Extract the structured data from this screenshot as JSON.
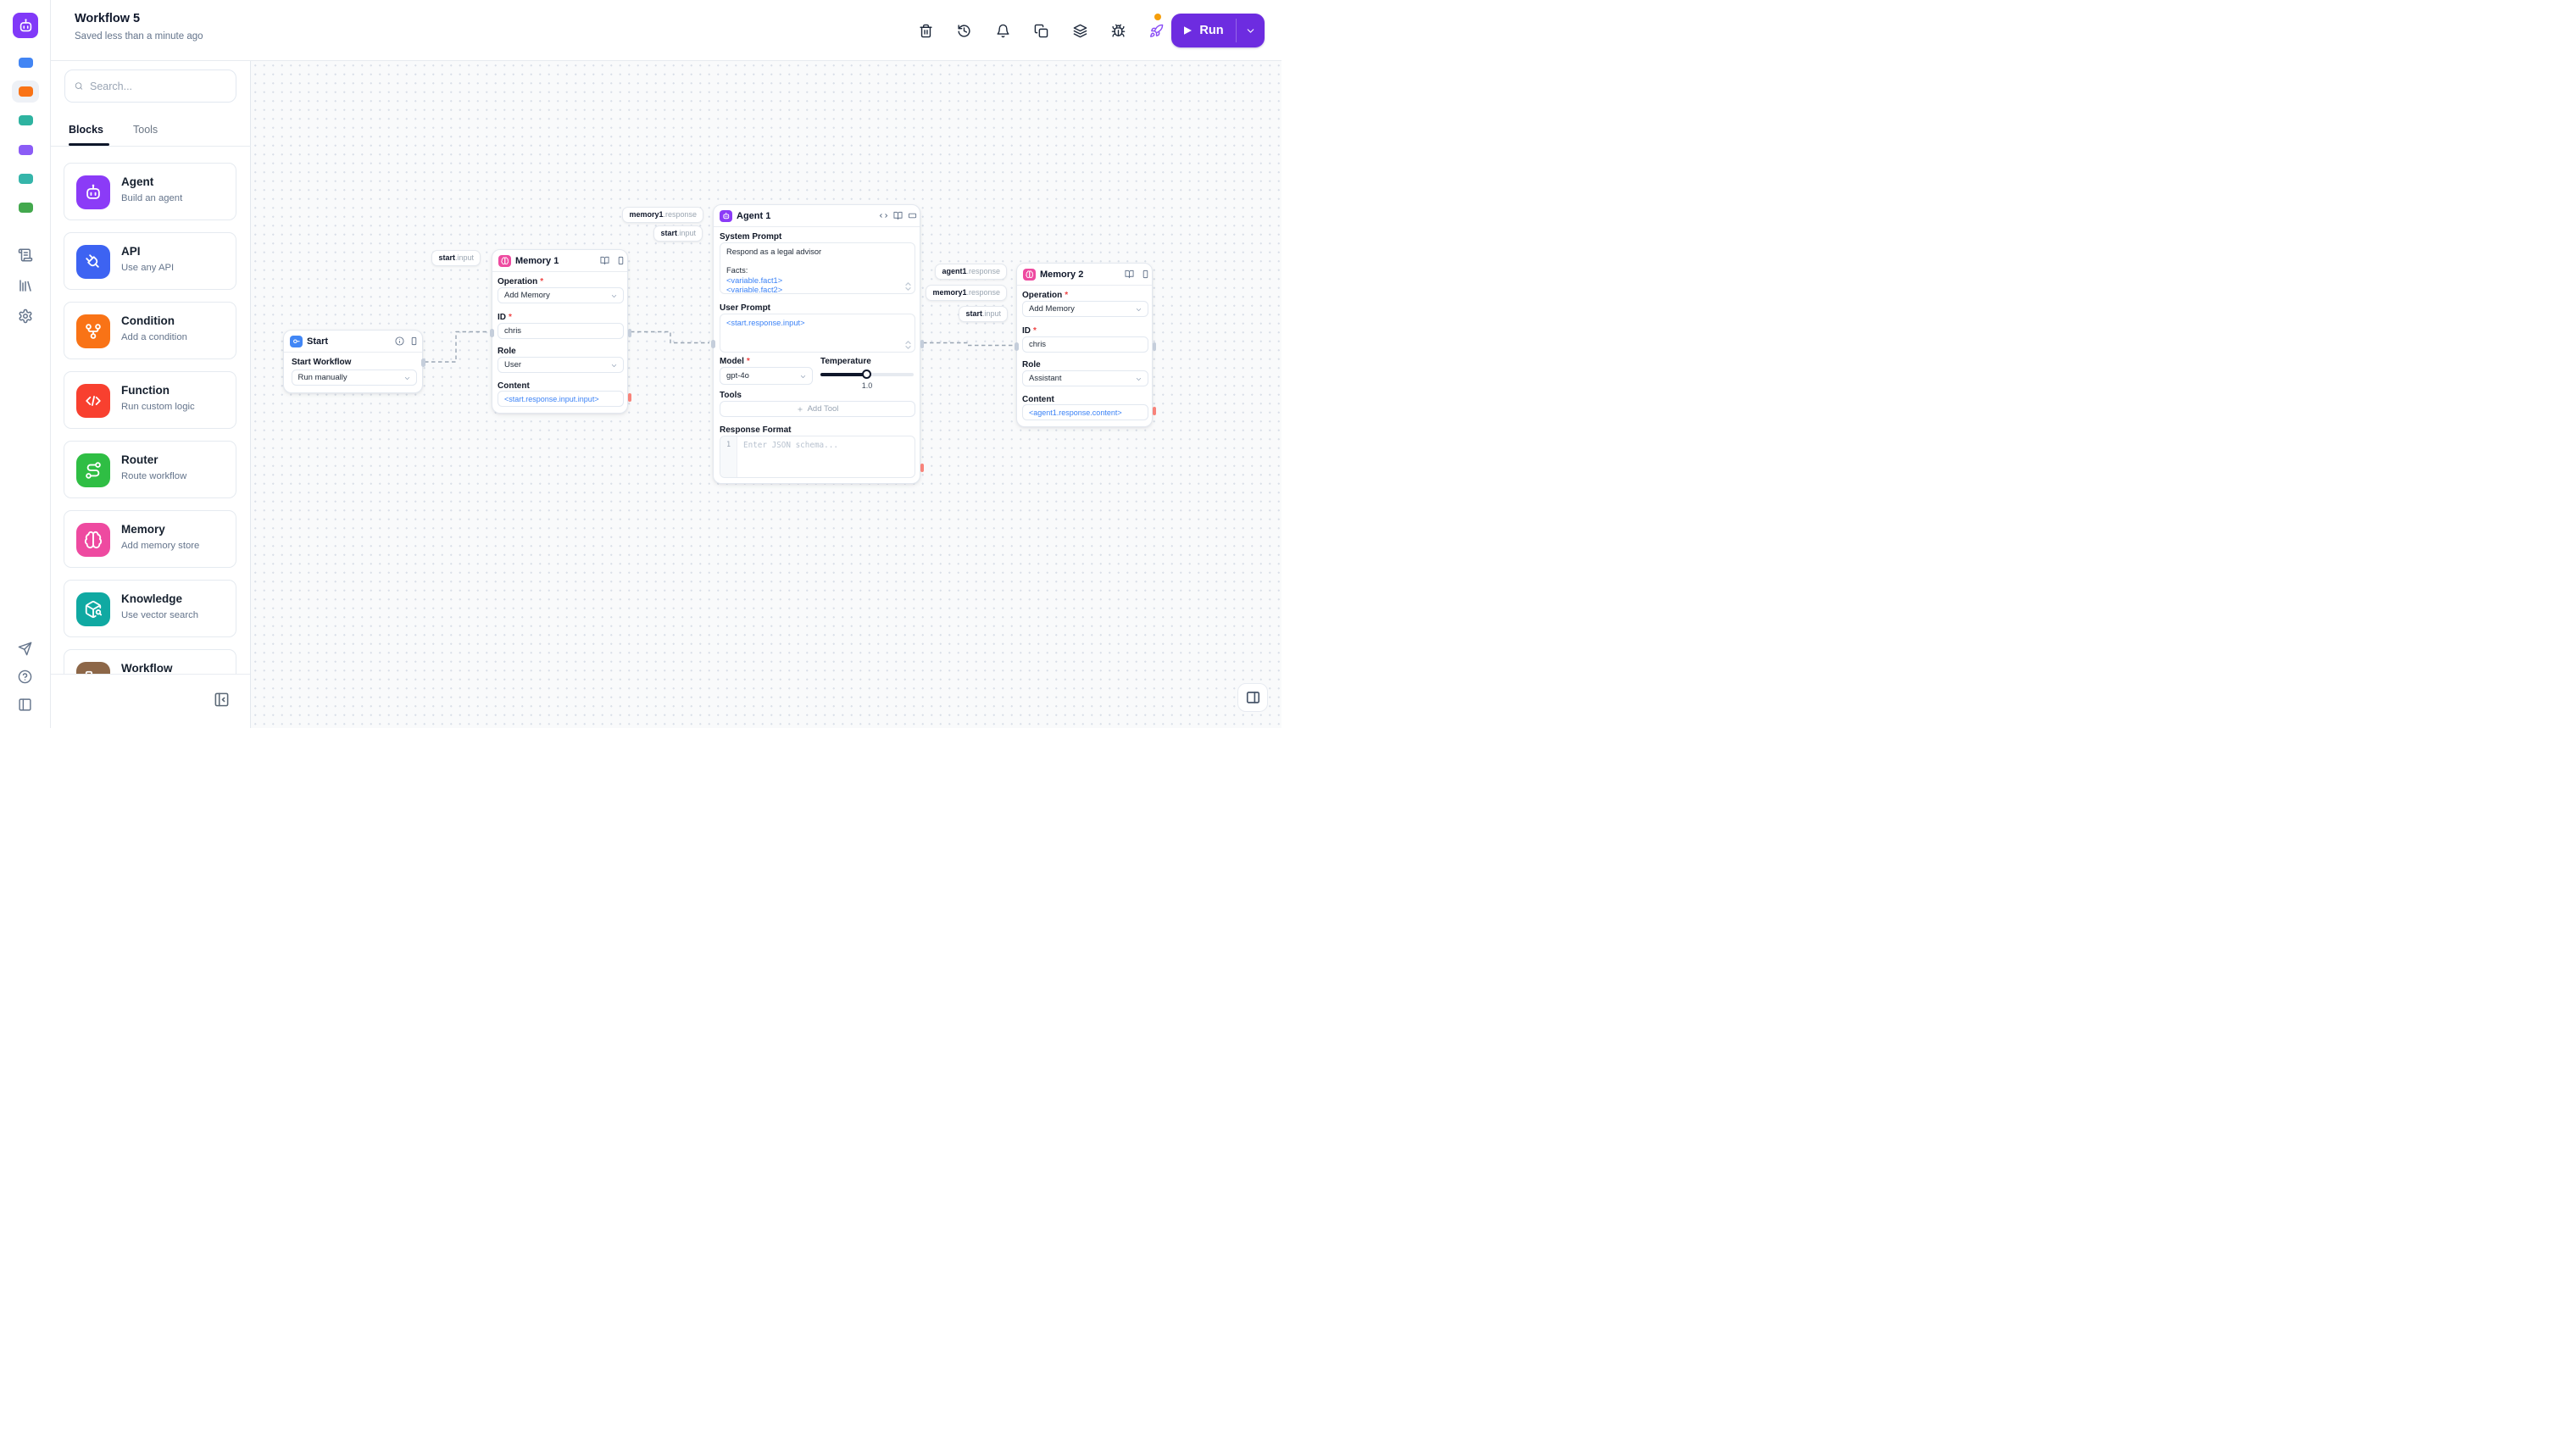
{
  "header": {
    "title": "Workflow 5",
    "subtitle": "Saved less than a minute ago",
    "run_label": "Run"
  },
  "rail": {
    "chips": [
      "#4285f4",
      "#f97316",
      "#2eb3a0",
      "#8b5cf6",
      "#35b5aa",
      "#43a84d"
    ]
  },
  "panel": {
    "search_placeholder": "Search...",
    "tabs": [
      {
        "label": "Blocks"
      },
      {
        "label": "Tools"
      }
    ],
    "blocks": [
      {
        "name": "Agent",
        "desc": "Build an agent",
        "color": "#8b3bf7"
      },
      {
        "name": "API",
        "desc": "Use any API",
        "color": "#3d63f2"
      },
      {
        "name": "Condition",
        "desc": "Add a condition",
        "color": "#f97316"
      },
      {
        "name": "Function",
        "desc": "Run custom logic",
        "color": "#f8402f"
      },
      {
        "name": "Router",
        "desc": "Route workflow",
        "color": "#2fbe44"
      },
      {
        "name": "Memory",
        "desc": "Add memory store",
        "color": "#ee4aa0"
      },
      {
        "name": "Knowledge",
        "desc": "Use vector search",
        "color": "#10a9a2"
      },
      {
        "name": "Workflow",
        "desc": "",
        "color": "#8d6748"
      }
    ]
  },
  "canvas": {
    "nodes": {
      "start": {
        "title": "Start",
        "workflow_label": "Start Workflow",
        "workflow_value": "Run manually"
      },
      "memory1": {
        "title": "Memory 1",
        "operation_label": "Operation",
        "operation_value": "Add Memory",
        "id_label": "ID",
        "id_value": "chris",
        "role_label": "Role",
        "role_value": "User",
        "content_label": "Content",
        "content_value": "<start.response.input.input>"
      },
      "agent1": {
        "title": "Agent 1",
        "system_prompt_label": "System Prompt",
        "prompt_line_1": "Respond as a legal advisor",
        "prompt_line_2": "Facts:",
        "prompt_var_1": "<variable.fact1>",
        "prompt_var_2": "<variable.fact2>",
        "user_prompt_label": "User Prompt",
        "user_prompt_value": "<start.response.input>",
        "model_label": "Model",
        "model_value": "gpt-4o",
        "temperature_label": "Temperature",
        "temperature_value": "1.0",
        "tools_label": "Tools",
        "add_tool_label": "Add Tool",
        "response_format_label": "Response Format",
        "response_format_placeholder": "Enter JSON schema...",
        "gutter_line": "1"
      },
      "memory2": {
        "title": "Memory 2",
        "operation_label": "Operation",
        "operation_value": "Add Memory",
        "id_label": "ID",
        "id_value": "chris",
        "role_label": "Role",
        "role_value": "Assistant",
        "content_label": "Content",
        "content_value": "<agent1.response.content>"
      }
    },
    "tags": [
      {
        "bold": "start",
        "rest": ".input"
      },
      {
        "bold": "memory1",
        "rest": ".response"
      },
      {
        "bold": "start",
        "rest": ".input"
      },
      {
        "bold": "agent1",
        "rest": ".response"
      },
      {
        "bold": "memory1",
        "rest": ".response"
      },
      {
        "bold": "start",
        "rest": ".input"
      }
    ]
  },
  "colors": {
    "accent": "#6d2ce0",
    "logo": "#8139f8",
    "notification_dot": "#f59e0b",
    "reference_blue": "#3b82f6",
    "handle_red": "#f8837a"
  }
}
